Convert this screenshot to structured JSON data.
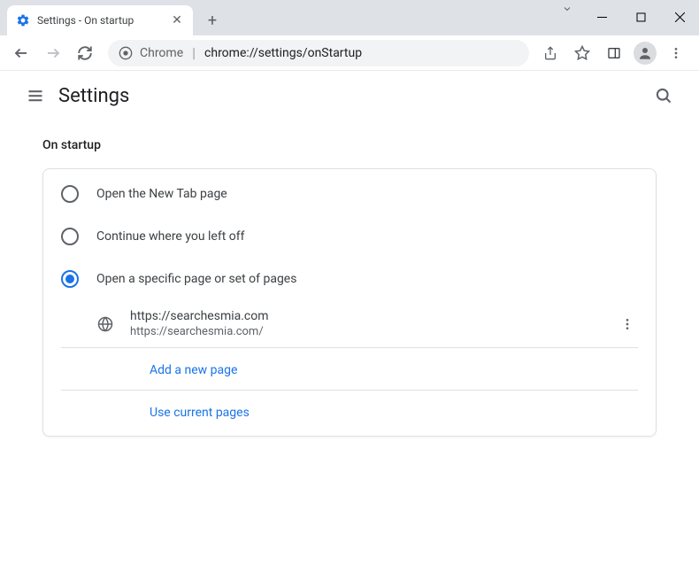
{
  "window": {
    "tab_title": "Settings - On startup"
  },
  "toolbar": {
    "origin_label": "Chrome",
    "url": "chrome://settings/onStartup"
  },
  "header": {
    "title": "Settings"
  },
  "section": {
    "label": "On startup",
    "options": [
      {
        "label": "Open the New Tab page",
        "selected": false
      },
      {
        "label": "Continue where you left off",
        "selected": false
      },
      {
        "label": "Open a specific page or set of pages",
        "selected": true
      }
    ],
    "pages": [
      {
        "title": "https://searchesmia.com",
        "url": "https://searchesmia.com/"
      }
    ],
    "actions": {
      "add": "Add a new page",
      "use_current": "Use current pages"
    }
  }
}
